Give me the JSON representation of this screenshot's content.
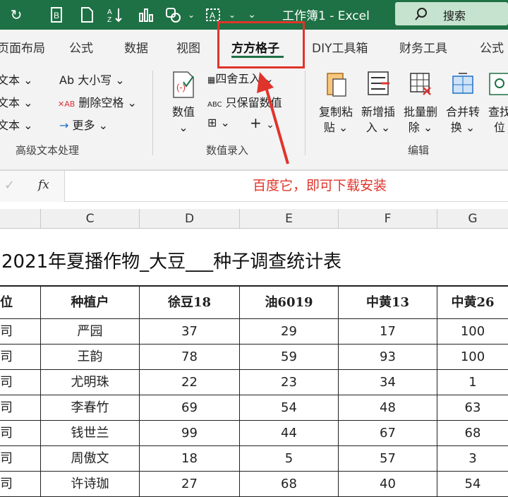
{
  "window": {
    "title": "工作簿1  -  Excel",
    "search_label": "搜索"
  },
  "tabs": [
    "页面布局",
    "公式",
    "数据",
    "视图",
    "方方格子",
    "DIY工具箱",
    "财务工具",
    "公式"
  ],
  "ribbon": {
    "text_group": {
      "items": [
        "文本",
        "文本",
        "文本"
      ],
      "size": "Ab 大小写",
      "del_space": "删除空格",
      "more": "更多",
      "label": "高级文本处理"
    },
    "number_group": {
      "big_btn": "数值",
      "round": "四舍五入",
      "keep_value": "只保留数值",
      "label": "数值录入"
    },
    "edit_group": {
      "buttons": [
        "复制粘贴",
        "新增插入",
        "批量删除",
        "合并转换",
        "查找定位"
      ],
      "label": "编辑"
    }
  },
  "formula_bar": {
    "fx": "fx",
    "annotation": "百度它，即可下载安装"
  },
  "columns": [
    "C",
    "D",
    "E",
    "F",
    "G"
  ],
  "sheet": {
    "title": "2021年夏播作物_大豆___种子调查统计表",
    "headers": [
      "位",
      "种植户",
      "徐豆18",
      "油6019",
      "中黄13",
      "中黄26"
    ],
    "rows": [
      [
        "司",
        "严园",
        "37",
        "29",
        "17",
        "100"
      ],
      [
        "司",
        "王韵",
        "78",
        "59",
        "93",
        "100"
      ],
      [
        "司",
        "尤明珠",
        "22",
        "23",
        "34",
        "1"
      ],
      [
        "司",
        "李春竹",
        "69",
        "54",
        "48",
        "63"
      ],
      [
        "司",
        "钱世兰",
        "99",
        "44",
        "67",
        "68"
      ],
      [
        "司",
        "周傲文",
        "18",
        "5",
        "57",
        "3"
      ],
      [
        "司",
        "许诗珈",
        "27",
        "68",
        "40",
        "54"
      ]
    ]
  },
  "colors": {
    "excel_green": "#1e7145",
    "annotation_red": "#e0342b"
  }
}
